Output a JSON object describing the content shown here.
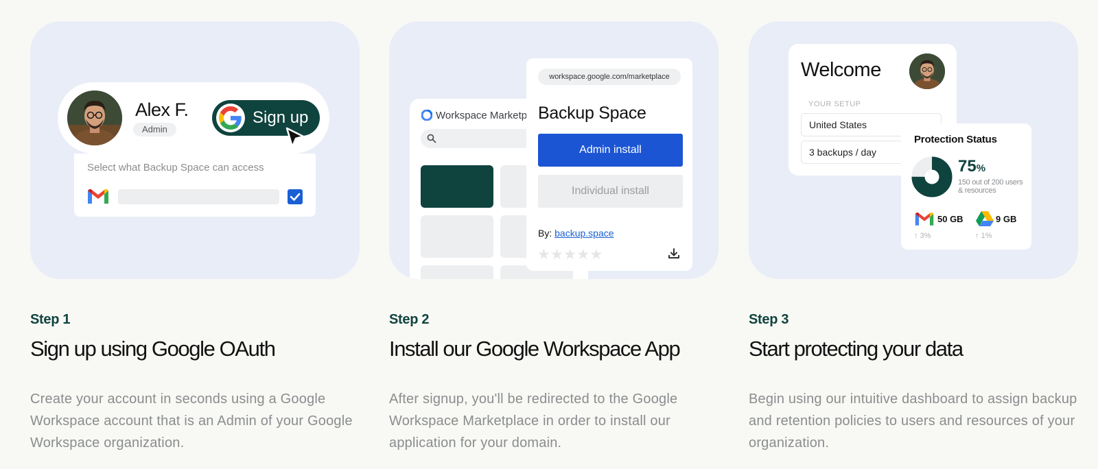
{
  "steps": [
    {
      "label": "Step 1",
      "title": "Sign up using Google OAuth",
      "description": "Create your account in seconds using a Google Workspace account that is an Admin of your Google Workspace organization."
    },
    {
      "label": "Step 2",
      "title": "Install our Google Workspace App",
      "description": "After signup, you'll be redirected to the Google Workspace Marketplace in order to install our application for your domain."
    },
    {
      "label": "Step 3",
      "title": "Start protecting your data",
      "description": "Begin using our intuitive dashboard to assign backup and retention policies to users and resources of your organization."
    }
  ],
  "signup_card": {
    "user_name": "Alex F.",
    "user_role": "Admin",
    "signup_label": "Sign up",
    "access_label": "Select what Backup Space can access",
    "gmail_checked": true
  },
  "marketplace_card": {
    "marketplace_label": "Workspace Marketplace",
    "url": "workspace.google.com/marketplace",
    "app_name": "Backup Space",
    "admin_install_label": "Admin install",
    "individual_install_label": "Individual install",
    "by_label": "By:",
    "by_link": "backup.space",
    "rating_stars": "★★★★★"
  },
  "dashboard_card": {
    "welcome": "Welcome",
    "setup_label": "YOUR SETUP",
    "country": "United States",
    "backups": "3 backups / day",
    "protection_title": "Protection Status",
    "protection_percent": "75",
    "percent_sign": "%",
    "protection_sub": "150 out of 200 users & resources",
    "gmail_size": "50 GB",
    "gmail_delta": "↑ 3%",
    "drive_size": "9 GB",
    "drive_delta": "↑ 1%"
  },
  "colors": {
    "accent_dark_green": "#0f433e",
    "primary_blue": "#1b55d4",
    "card_background": "#e8edf7",
    "page_background": "#f8f8f4"
  }
}
